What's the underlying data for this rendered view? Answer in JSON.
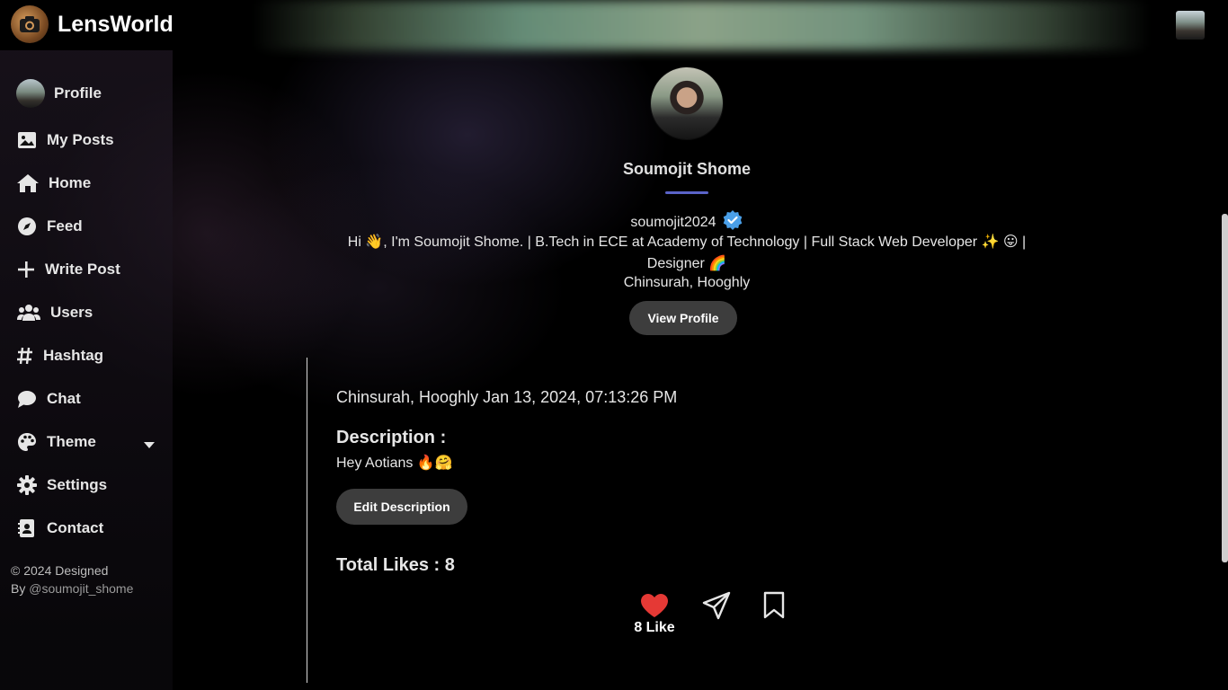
{
  "app": {
    "name": "LensWorld"
  },
  "sidebar": {
    "items": [
      {
        "label": "Profile",
        "icon": "avatar"
      },
      {
        "label": "My Posts",
        "icon": "image-icon"
      },
      {
        "label": "Home",
        "icon": "home-icon"
      },
      {
        "label": "Feed",
        "icon": "compass-icon"
      },
      {
        "label": "Write Post",
        "icon": "plus-icon"
      },
      {
        "label": "Users",
        "icon": "users-icon"
      },
      {
        "label": "Hashtag",
        "icon": "hashtag-icon"
      },
      {
        "label": "Chat",
        "icon": "chat-bubble-icon"
      },
      {
        "label": "Theme",
        "icon": "palette-icon"
      },
      {
        "label": "Settings",
        "icon": "gear-icon"
      },
      {
        "label": "Contact",
        "icon": "contact-card-icon"
      }
    ],
    "footer": {
      "line1": "© 2024 Designed",
      "by": "By",
      "handle": "@soumojit_shome"
    }
  },
  "profile": {
    "name": "Soumojit Shome",
    "username": "soumojit2024",
    "bio": "Hi 👋, I'm Soumojit Shome. | B.Tech in ECE at Academy of Technology | Full Stack Web Developer ✨ 😛 | Designer 🌈",
    "location": "Chinsurah, Hooghly",
    "view_profile_label": "View Profile"
  },
  "post": {
    "meta": "Chinsurah, Hooghly Jan 13, 2024, 07:13:26 PM",
    "description_heading": "Description :",
    "description": "Hey Aotians 🔥🤗",
    "edit_label": "Edit Description",
    "total_likes_label": "Total Likes : 8",
    "like_count_label": "8 Like"
  },
  "colors": {
    "accent_underline": "#5a63c8",
    "like_red": "#e53935",
    "verified_blue": "#4a9fe8"
  }
}
